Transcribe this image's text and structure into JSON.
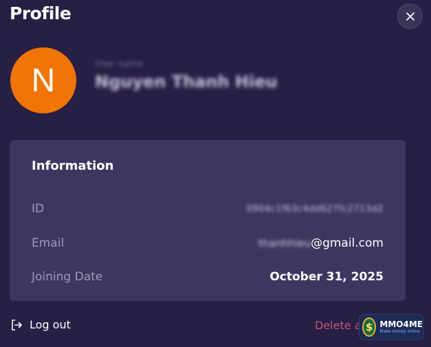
{
  "page": {
    "title": "Profile"
  },
  "avatar": {
    "initial": "N",
    "color": "#f07406"
  },
  "user": {
    "label": "User name",
    "name": "Nguyen Thanh Hieu"
  },
  "info": {
    "title": "Information",
    "rows": [
      {
        "label": "ID",
        "value": "0904c1f63c4dd627fc2713d2"
      },
      {
        "label": "Email",
        "value_hidden": "thanhhieu",
        "value_visible": "@gmail.com"
      },
      {
        "label": "Joining Date",
        "value": "October 31, 2025"
      }
    ]
  },
  "actions": {
    "logout": "Log out",
    "delete": "Delete a"
  },
  "watermark": {
    "title": "MMO4ME",
    "subtitle": "Make money online",
    "coin": "$"
  },
  "icons": {
    "close": "close-icon",
    "logout": "logout-icon"
  },
  "colors": {
    "background": "#281f45",
    "card": "#3f3660",
    "delete": "#c0577a"
  }
}
